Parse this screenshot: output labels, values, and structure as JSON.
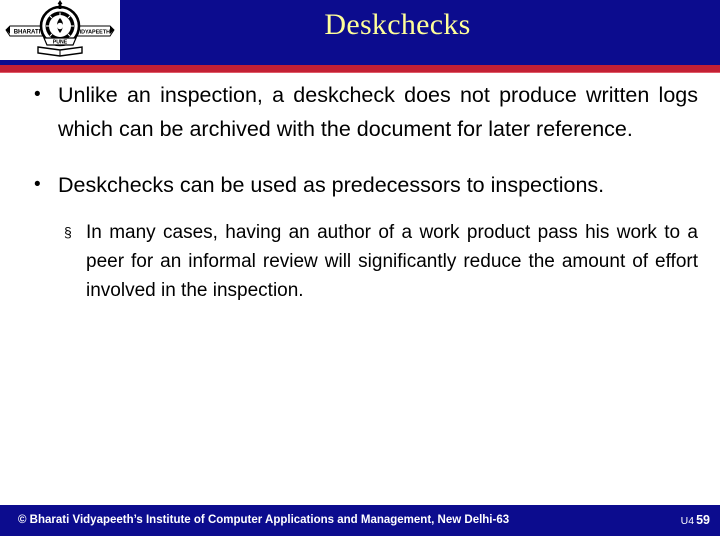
{
  "slide": {
    "title": "Deskchecks",
    "colors": {
      "header_blue": "#0c0c8e",
      "title_yellow": "#ffff99",
      "rule_red": "#c32034",
      "body_text": "#000000",
      "background": "#ffffff",
      "footer_text": "#ffffff"
    }
  },
  "logo": {
    "name": "bharati-vidyapeeth-logo",
    "banner_left": "BHARATI",
    "banner_right": "VIDYAPEETH",
    "scroll_text": "PUNE"
  },
  "body": {
    "bullets": [
      {
        "marker": "•",
        "level": 1,
        "text": "Unlike an inspection, a deskcheck does not produce written logs which can be archived with the document for later reference."
      },
      {
        "marker": "•",
        "level": 1,
        "text": "Deskchecks can be used as predecessors to inspections."
      },
      {
        "marker": "§",
        "level": 2,
        "text": "In many cases, having an author of a work product pass his work to a peer for an informal review will significantly reduce the amount of effort involved in the inspection."
      }
    ]
  },
  "footer": {
    "credit": "© Bharati Vidyapeeth’s Institute of Computer Applications and Management, New Delhi-63",
    "unit": "U4",
    "page_number": "59"
  }
}
